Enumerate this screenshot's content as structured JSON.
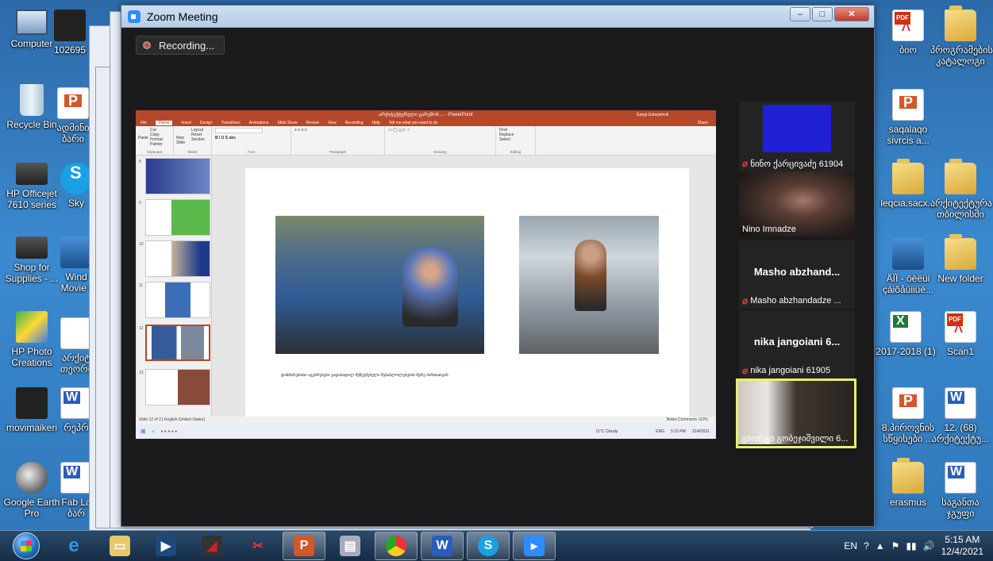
{
  "desktop": {
    "left_icons": [
      {
        "label": "Computer",
        "type": "computer"
      },
      {
        "label": "102695",
        "type": "dark"
      },
      {
        "label": "Recycle Bin",
        "type": "bin"
      },
      {
        "label": "ადმინი ბარი",
        "type": "ppt"
      },
      {
        "label": "HP Officejet 7610 series",
        "type": "printer"
      },
      {
        "label": "Sky",
        "type": "skype"
      },
      {
        "label": "Shop for Supplies - ...",
        "type": "printer"
      },
      {
        "label": "Wind Movie I",
        "type": "generic"
      },
      {
        "label": "HP Photo Creations",
        "type": "photo"
      },
      {
        "label": "არქიტ თეორი",
        "type": "doc"
      },
      {
        "label": "movimaikeri",
        "type": "dark"
      },
      {
        "label": "რეპრ",
        "type": "word"
      },
      {
        "label": "Google Earth Pro",
        "type": "globe"
      },
      {
        "label": "Fab La ბარ",
        "type": "word"
      }
    ],
    "right_icons": [
      {
        "label": "ბიო",
        "type": "pdf"
      },
      {
        "label": "პროგრამების კატალოგი",
        "type": "folder"
      },
      {
        "label": "saqalaqo sivrcis a...",
        "type": "ppt"
      },
      {
        "label": "leqcia.sacx...",
        "type": "folder"
      },
      {
        "label": "არქიტექტურა თბილისში",
        "type": "folder"
      },
      {
        "label": "ÄÏÏ - ôèëüi çàiõåúiiüé...",
        "type": "generic"
      },
      {
        "label": "New folder",
        "type": "folder"
      },
      {
        "label": "2017-2018 (1)",
        "type": "excel"
      },
      {
        "label": "Scan1",
        "type": "pdf"
      },
      {
        "label": "8.პიროვნის სწყისები ...",
        "type": "ppt"
      },
      {
        "label": "12. (68) არქიტექტუ...",
        "type": "word"
      },
      {
        "label": "erasmus",
        "type": "folder"
      },
      {
        "label": "საგანთა ჯგუფი",
        "type": "word"
      }
    ]
  },
  "zoom": {
    "title": "Zoom Meeting",
    "recording_label": "Recording...",
    "window_buttons": {
      "minimize": "–",
      "maximize": "□",
      "close": "✕"
    }
  },
  "powerpoint": {
    "title": "არქიტექტურული გარემოს ... - PowerPoint",
    "user": "Giorgi Gobejishvili",
    "tabs": [
      "File",
      "Home",
      "Insert",
      "Design",
      "Transitions",
      "Animations",
      "Slide Show",
      "Review",
      "View",
      "Recording",
      "Help",
      "Tell me what you want to do"
    ],
    "active_tab": "Home",
    "share_label": "Share",
    "ribbon_groups": [
      "Clipboard",
      "Slides",
      "Font",
      "Paragraph",
      "Drawing",
      "Editing"
    ],
    "clipboard_items": [
      "Cut",
      "Copy",
      "Format Painter"
    ],
    "paste_label": "Paste",
    "slides_items": [
      "Layout",
      "Reset",
      "Section"
    ],
    "new_slide_label": "New Slide",
    "editing_items": [
      "Find",
      "Replace",
      "Select"
    ],
    "thumbnail_numbers": [
      "8",
      "9",
      "10",
      "11",
      "12",
      "13"
    ],
    "slide_caption": "დახმარებითი აგებრებები გადაბადილ მუზეუმებული შებაბლოლებების შერე პირთათვის",
    "status_left": "Slide 12 of 21   English (United States)",
    "status_right": "Notes   Comments   110%",
    "weather": "11°C Cloudy",
    "mini_time": "5:15 PM",
    "mini_date": "12/4/2021",
    "mini_lang": "ENG"
  },
  "participants": [
    {
      "name": "ნინო ქარცივაძე 61904",
      "muted": true,
      "big_name": ""
    },
    {
      "name": "Nino Imnadze",
      "muted": false,
      "big_name": ""
    },
    {
      "name": "Masho abzhandadze ...",
      "muted": true,
      "big_name": "Masho abzhand..."
    },
    {
      "name": "nika jangoiani 61905",
      "muted": true,
      "big_name": "nika jangoiani 6..."
    },
    {
      "name": "გიორგი გობეჯიშვილი 6...",
      "muted": false,
      "big_name": ""
    }
  ],
  "taskbar": {
    "apps": [
      "ie",
      "explorer",
      "davinci",
      "inkscape",
      "snip",
      "powerpoint",
      "scanner",
      "chrome",
      "word",
      "skype",
      "zoom"
    ],
    "lang": "EN",
    "time": "5:15 AM",
    "date": "12/4/2021"
  },
  "colors": {
    "ppt_accent": "#b7472a",
    "zoom_active_border": "#e6f06e",
    "mic_off": "#e23b3b"
  }
}
